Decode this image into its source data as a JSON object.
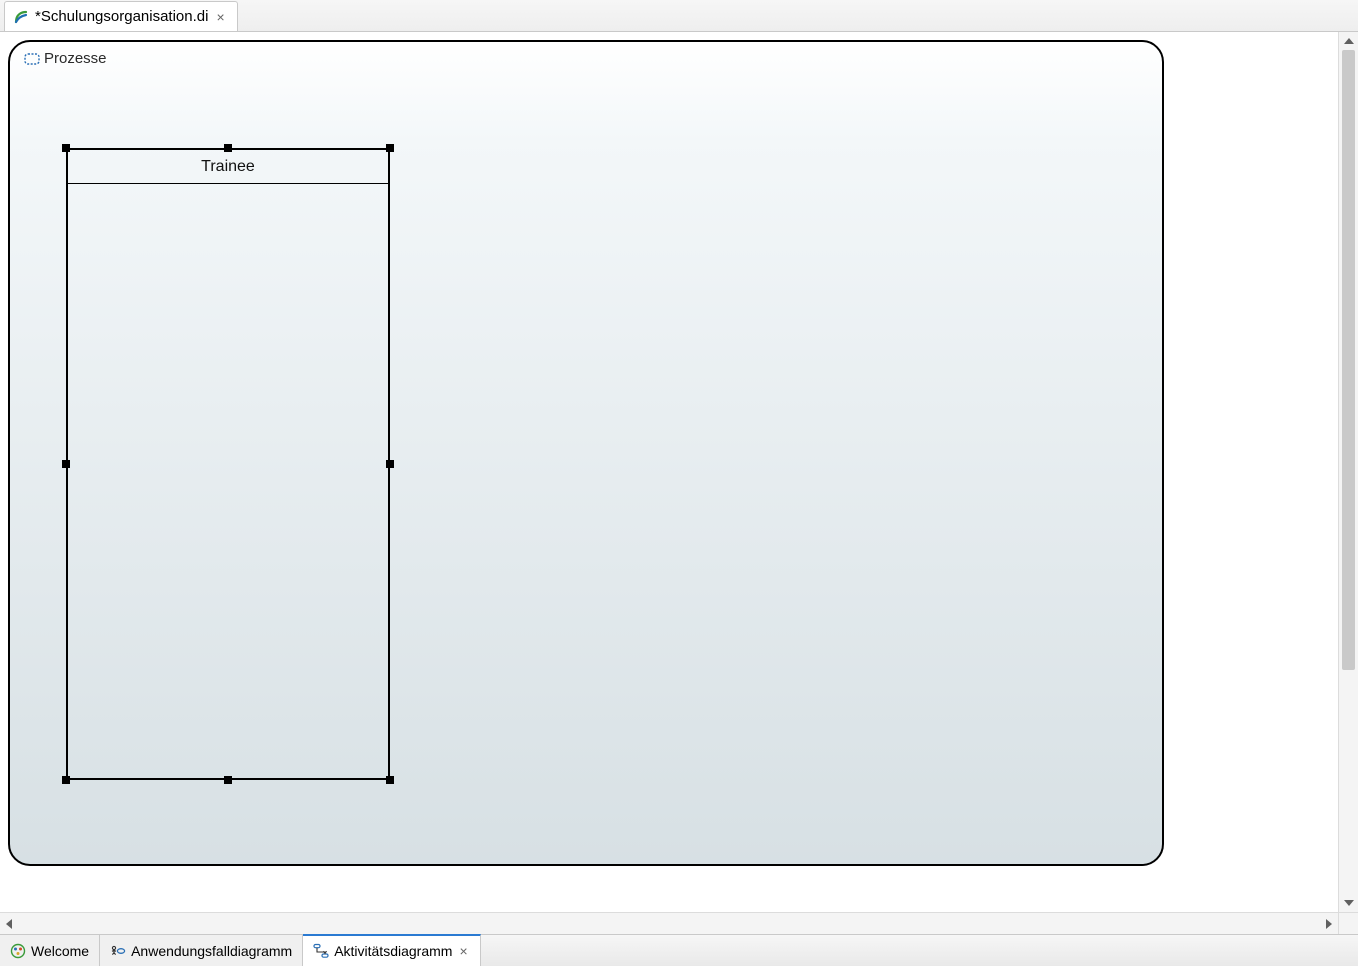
{
  "topTabs": [
    {
      "label": "*Schulungsorganisation.di",
      "closeable": true,
      "active": true
    }
  ],
  "diagram": {
    "frame_title": "Prozesse",
    "partition_name": "Trainee"
  },
  "bottomTabs": [
    {
      "id": "welcome",
      "label": "Welcome",
      "closeable": false,
      "active": false,
      "icon": "welcome"
    },
    {
      "id": "usecase",
      "label": "Anwendungsfalldiagramm",
      "closeable": false,
      "active": false,
      "icon": "usecase"
    },
    {
      "id": "activity",
      "label": "Aktivitätsdiagramm",
      "closeable": true,
      "active": true,
      "icon": "activity"
    }
  ]
}
